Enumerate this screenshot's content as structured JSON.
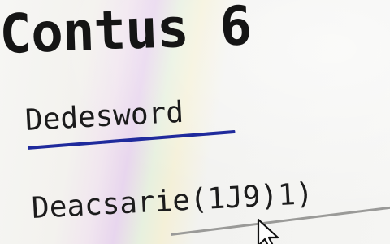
{
  "app": {
    "title": "Contus 6"
  },
  "section": {
    "link_label": "Dedesword"
  },
  "field": {
    "label": "Deacsarie(1J9)1)"
  },
  "colors": {
    "link_underline": "#1f2a9c",
    "text": "#151515"
  },
  "icons": {
    "pointer": "mouse-pointer-icon"
  }
}
